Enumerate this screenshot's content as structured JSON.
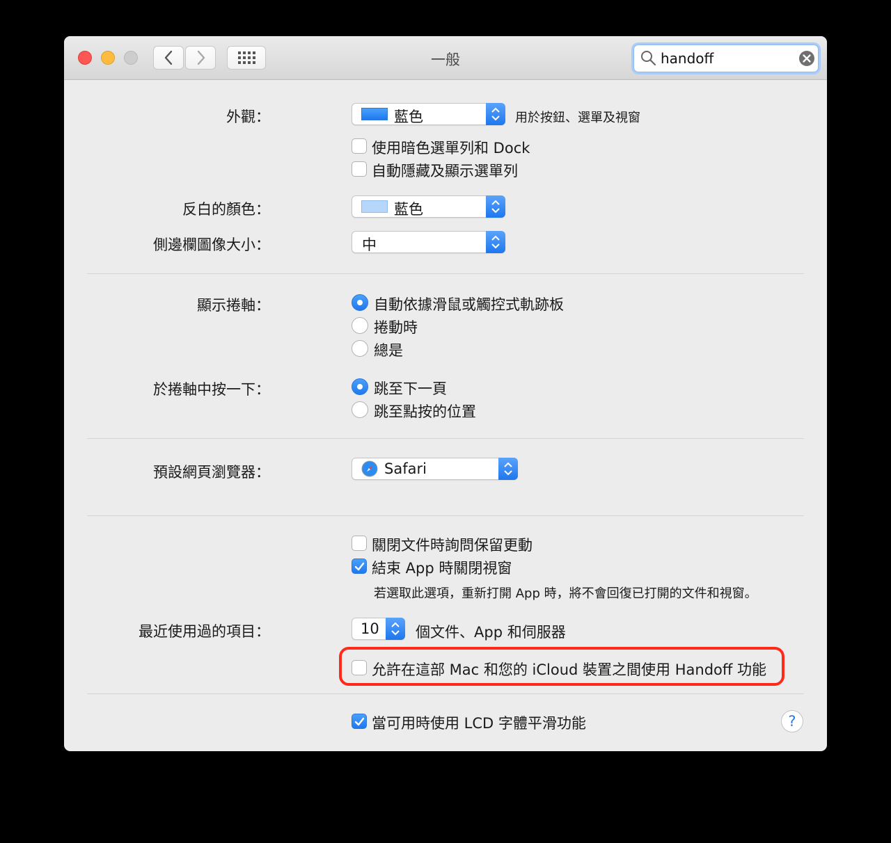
{
  "window": {
    "title": "一般"
  },
  "search": {
    "value": "handoff"
  },
  "icons": {
    "back": "chevron-left-icon",
    "forward": "chevron-right-icon",
    "show_all": "grid-icon",
    "search": "magnifier-icon",
    "clear": "clear-icon",
    "help": "question-icon"
  },
  "colors": {
    "accent": "#1f78ee",
    "highlight_swatch": "#b6d7fb",
    "annotation": "#ff2a1a"
  },
  "appearance": {
    "label": "外觀：",
    "value": "藍色",
    "hint": "用於按鈕、選單及視窗",
    "dark_menu": {
      "label": "使用暗色選單列和 Dock",
      "checked": false
    },
    "auto_hide_menu": {
      "label": "自動隱藏及顯示選單列",
      "checked": false
    }
  },
  "highlight_color": {
    "label": "反白的顏色：",
    "value": "藍色"
  },
  "sidebar_icon_size": {
    "label": "側邊欄圖像大小：",
    "value": "中"
  },
  "show_scrollbars": {
    "label": "顯示捲軸：",
    "options": [
      "自動依據滑鼠或觸控式軌跡板",
      "捲動時",
      "總是"
    ],
    "selected": 0
  },
  "click_scrollbar": {
    "label": "於捲軸中按一下：",
    "options": [
      "跳至下一頁",
      "跳至點按的位置"
    ],
    "selected": 0
  },
  "default_browser": {
    "label": "預設網頁瀏覽器：",
    "value": "Safari"
  },
  "ask_keep_changes": {
    "label": "關閉文件時詢問保留更動",
    "checked": false
  },
  "close_windows": {
    "label": "結束 App 時關閉視窗",
    "checked": true,
    "note": "若選取此選項，重新打開 App 時，將不會回復已打開的文件和視窗。"
  },
  "recent_items": {
    "label": "最近使用過的項目：",
    "value": "10",
    "suffix": "個文件、App 和伺服器"
  },
  "handoff": {
    "label": "允許在這部 Mac 和您的 iCloud 裝置之間使用 Handoff 功能",
    "checked": false
  },
  "lcd_smoothing": {
    "label": "當可用時使用 LCD 字體平滑功能",
    "checked": true
  },
  "help": {
    "label": "?"
  }
}
